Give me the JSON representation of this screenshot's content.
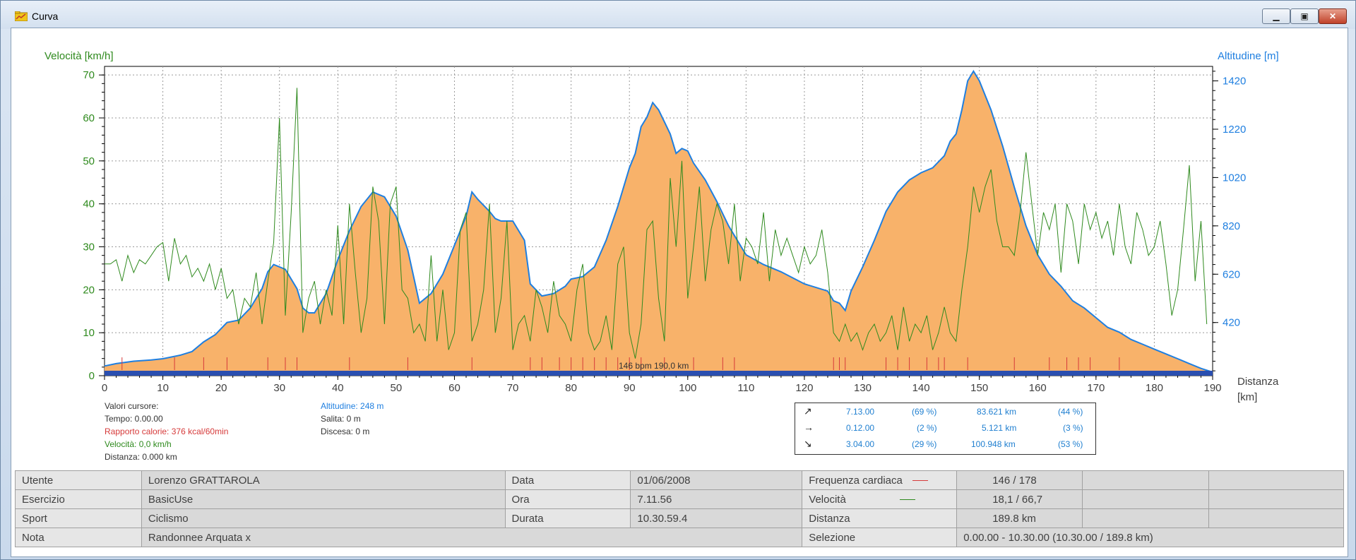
{
  "window": {
    "title": "Curva"
  },
  "chart_data": {
    "type": "area",
    "left_axis": {
      "label": "Velocità [km/h]",
      "ticks": [
        0,
        10,
        20,
        30,
        40,
        50,
        60,
        70
      ],
      "range": [
        0,
        72
      ]
    },
    "right_axis": {
      "label": "Altitudine [m]",
      "ticks": [
        420,
        620,
        820,
        1020,
        1220,
        1420
      ],
      "range": [
        200,
        1480
      ]
    },
    "x_axis": {
      "label_line1": "Distanza",
      "label_line2": "[km]",
      "ticks": [
        0,
        10,
        20,
        30,
        40,
        50,
        60,
        70,
        80,
        90,
        100,
        110,
        120,
        130,
        140,
        150,
        160,
        170,
        180,
        190
      ],
      "range": [
        0,
        190
      ]
    },
    "grid": true,
    "altitude": {
      "distance_km": [
        0,
        2,
        5,
        8,
        10,
        13,
        15,
        17,
        19,
        21,
        23,
        25,
        27,
        28,
        29,
        31,
        33,
        34,
        35,
        36,
        38,
        40,
        42,
        44,
        46,
        48,
        50,
        52,
        54,
        56,
        58,
        60,
        62,
        63,
        64,
        66,
        67,
        68,
        70,
        72,
        73,
        75,
        77,
        79,
        80,
        82,
        84,
        86,
        88,
        90,
        91,
        92,
        93,
        94,
        95,
        96,
        97,
        98,
        99,
        100,
        101,
        103,
        105,
        107,
        109,
        110,
        113,
        116,
        120,
        124,
        125,
        126,
        127,
        128,
        130,
        132,
        134,
        136,
        138,
        140,
        142,
        144,
        145,
        146,
        147,
        148,
        149,
        150,
        152,
        154,
        156,
        158,
        160,
        162,
        164,
        166,
        168,
        170,
        172,
        174,
        176,
        178,
        180,
        182,
        184,
        186,
        188,
        190
      ],
      "altitude_m": [
        240,
        250,
        260,
        265,
        270,
        285,
        300,
        340,
        370,
        420,
        430,
        480,
        560,
        630,
        660,
        640,
        560,
        480,
        460,
        460,
        540,
        680,
        800,
        900,
        960,
        940,
        860,
        720,
        500,
        540,
        620,
        740,
        860,
        960,
        930,
        880,
        850,
        840,
        840,
        760,
        580,
        530,
        540,
        570,
        600,
        610,
        650,
        760,
        900,
        1060,
        1120,
        1230,
        1270,
        1330,
        1300,
        1250,
        1200,
        1120,
        1140,
        1130,
        1080,
        1010,
        920,
        820,
        740,
        700,
        660,
        630,
        580,
        550,
        510,
        500,
        470,
        550,
        650,
        760,
        880,
        960,
        1010,
        1040,
        1060,
        1110,
        1170,
        1200,
        1300,
        1420,
        1460,
        1420,
        1300,
        1150,
        980,
        820,
        700,
        620,
        570,
        510,
        480,
        440,
        400,
        380,
        350,
        330,
        310,
        290,
        270,
        250,
        230,
        215
      ],
      "fill_color": "#f8b26a",
      "line_color": "#1f7fe0"
    },
    "speed": {
      "line_color": "#2f8a1e",
      "distance_km": [
        0,
        1,
        2,
        3,
        4,
        5,
        6,
        7,
        8,
        9,
        10,
        11,
        12,
        13,
        14,
        15,
        16,
        17,
        18,
        19,
        20,
        21,
        22,
        23,
        24,
        25,
        26,
        27,
        28,
        29,
        30,
        31,
        32,
        33,
        34,
        35,
        36,
        37,
        38,
        39,
        40,
        41,
        42,
        43,
        44,
        45,
        46,
        47,
        48,
        49,
        50,
        51,
        52,
        53,
        54,
        55,
        56,
        57,
        58,
        59,
        60,
        61,
        62,
        63,
        64,
        65,
        66,
        67,
        68,
        69,
        70,
        71,
        72,
        73,
        74,
        75,
        76,
        77,
        78,
        79,
        80,
        81,
        82,
        83,
        84,
        85,
        86,
        87,
        88,
        89,
        90,
        91,
        92,
        93,
        94,
        95,
        96,
        97,
        98,
        99,
        100,
        101,
        102,
        103,
        104,
        105,
        106,
        107,
        108,
        109,
        110,
        111,
        112,
        113,
        114,
        115,
        116,
        117,
        118,
        119,
        120,
        121,
        122,
        123,
        124,
        125,
        126,
        127,
        128,
        129,
        130,
        131,
        132,
        133,
        134,
        135,
        136,
        137,
        138,
        139,
        140,
        141,
        142,
        143,
        144,
        145,
        146,
        147,
        148,
        149,
        150,
        151,
        152,
        153,
        154,
        155,
        156,
        157,
        158,
        159,
        160,
        161,
        162,
        163,
        164,
        165,
        166,
        167,
        168,
        169,
        170,
        171,
        172,
        173,
        174,
        175,
        176,
        177,
        178,
        179,
        180,
        181,
        182,
        183,
        184,
        185,
        186,
        187,
        188,
        189
      ],
      "speed_kmh": [
        26,
        26,
        27,
        22,
        28,
        24,
        27,
        26,
        28,
        30,
        31,
        22,
        32,
        26,
        28,
        23,
        25,
        22,
        26,
        20,
        25,
        18,
        20,
        12,
        18,
        16,
        24,
        12,
        22,
        31,
        60,
        14,
        38,
        67,
        10,
        18,
        22,
        12,
        20,
        14,
        35,
        12,
        40,
        24,
        10,
        18,
        44,
        36,
        12,
        40,
        44,
        20,
        18,
        10,
        12,
        8,
        28,
        8,
        20,
        6,
        10,
        34,
        38,
        8,
        12,
        20,
        40,
        10,
        18,
        36,
        6,
        12,
        14,
        8,
        20,
        16,
        10,
        22,
        14,
        12,
        8,
        20,
        26,
        10,
        6,
        8,
        14,
        6,
        26,
        30,
        10,
        4,
        12,
        34,
        36,
        18,
        8,
        46,
        30,
        50,
        18,
        30,
        44,
        22,
        34,
        40,
        36,
        26,
        40,
        22,
        32,
        30,
        26,
        38,
        22,
        34,
        28,
        32,
        28,
        24,
        30,
        26,
        28,
        34,
        24,
        10,
        8,
        12,
        8,
        10,
        6,
        10,
        12,
        8,
        10,
        14,
        6,
        16,
        8,
        12,
        10,
        14,
        6,
        10,
        16,
        10,
        8,
        20,
        30,
        44,
        38,
        44,
        48,
        36,
        30,
        30,
        28,
        38,
        52,
        40,
        28,
        38,
        34,
        40,
        24,
        40,
        36,
        26,
        40,
        34,
        38,
        32,
        36,
        28,
        40,
        30,
        26,
        38,
        34,
        28,
        30,
        36,
        26,
        14,
        20,
        34,
        49,
        22,
        36,
        12
      ]
    },
    "markers_km": [
      3,
      12,
      17,
      21,
      28,
      31,
      33,
      42,
      52,
      63,
      73,
      75,
      78,
      80,
      82,
      84,
      86,
      88,
      90,
      92,
      96,
      101,
      106,
      108,
      125,
      126,
      127,
      134,
      136,
      138,
      141,
      143,
      144,
      148,
      156,
      162,
      165,
      167,
      169,
      174
    ],
    "marker_label": "146 bpm 190,0 km",
    "marker_color": "#d63a3a",
    "progress_bar_color": "#2a4fb0"
  },
  "cursor_values": {
    "heading": "Valori cursore:",
    "time": "Tempo: 0.00.00",
    "calories": "Rapporto calorie: 376 kcal/60min",
    "speed": "Velocità: 0,0 km/h",
    "distance": "Distanza: 0.000 km",
    "altitude": "Altitudine: 248 m",
    "climb": "Salita: 0 m",
    "descent": "Discesa: 0 m"
  },
  "summary": [
    {
      "icon": "arrow-up-right-icon",
      "glyph": "↗",
      "time": "7.13.00",
      "pct_time": "(69 %)",
      "dist": "83.621 km",
      "pct_dist": "(44 %)"
    },
    {
      "icon": "arrow-right-icon",
      "glyph": "→",
      "time": "0.12.00",
      "pct_time": "(2 %)",
      "dist": "5.121 km",
      "pct_dist": "(3 %)"
    },
    {
      "icon": "arrow-down-right-icon",
      "glyph": "↘",
      "time": "3.04.00",
      "pct_time": "(29 %)",
      "dist": "100.948 km",
      "pct_dist": "(53 %)"
    }
  ],
  "info": {
    "utente_label": "Utente",
    "utente_value": "Lorenzo  GRATTAROLA",
    "esercizio_label": "Esercizio",
    "esercizio_value": "BasicUse",
    "sport_label": "Sport",
    "sport_value": "Ciclismo",
    "nota_label": "Nota",
    "nota_value": "Randonnee Arquata x",
    "data_label": "Data",
    "data_value": "01/06/2008",
    "ora_label": "Ora",
    "ora_value": "7.11.56",
    "durata_label": "Durata",
    "durata_value": "10.30.59.4",
    "fc_label": "Frequenza cardiaca",
    "fc_value": "146 / 178",
    "fc_color": "#d63a3a",
    "vel_label": "Velocità",
    "vel_value": "18,1 / 66,7",
    "vel_color": "#2f8a1e",
    "dist_label": "Distanza",
    "dist_value": "189.8 km",
    "sel_label": "Selezione",
    "sel_value": "0.00.00 - 10.30.00 (10.30.00 / 189.8 km)"
  }
}
